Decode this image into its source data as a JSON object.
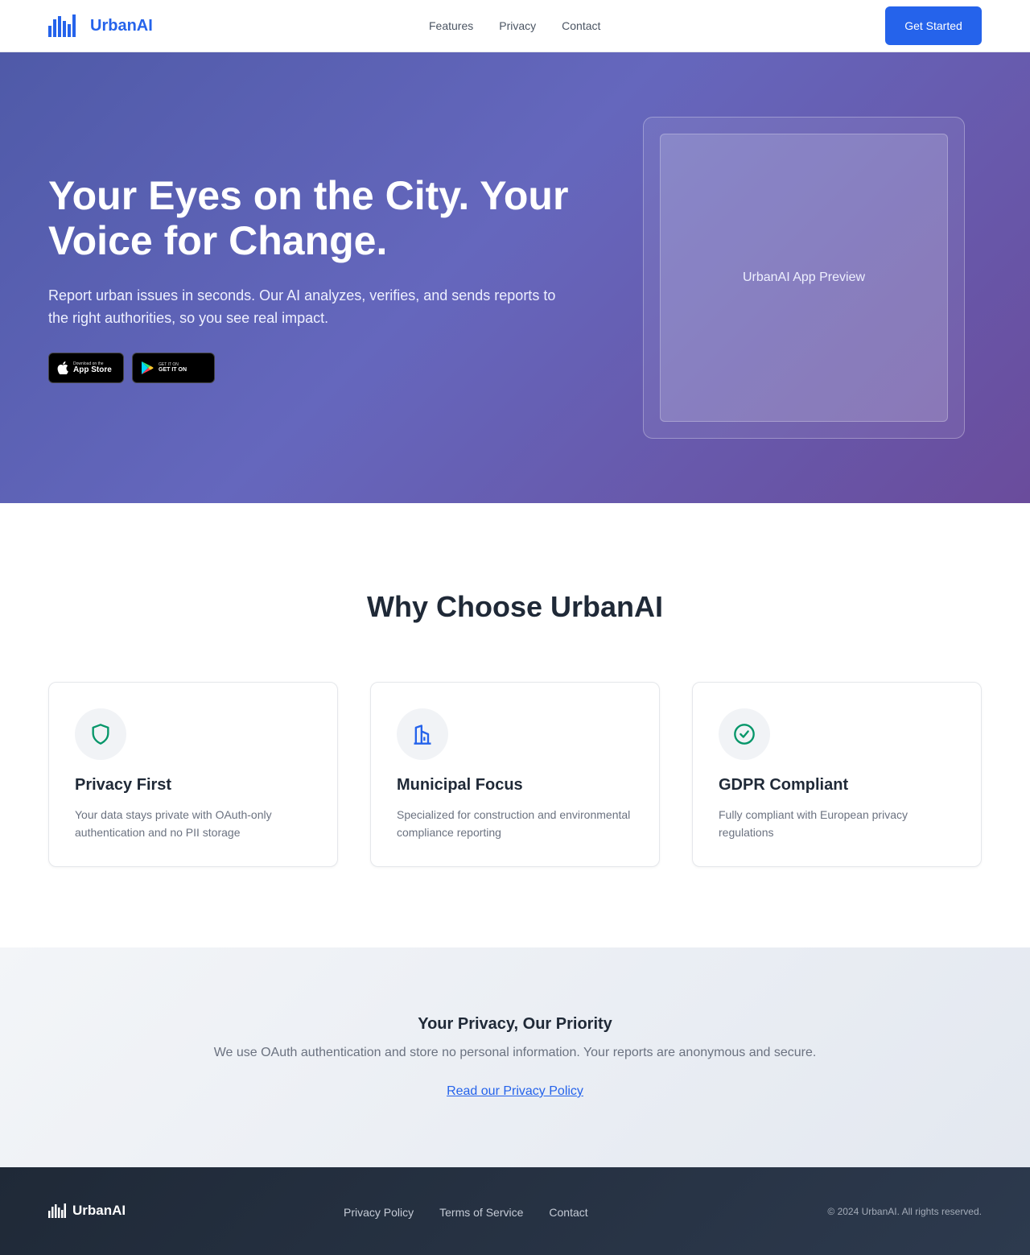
{
  "nav": {
    "brand": "UrbanAI",
    "links": [
      "Features",
      "Privacy",
      "Contact"
    ],
    "cta": "Get Started"
  },
  "hero": {
    "title": "Your Eyes on the City. Your Voice for Change.",
    "subtitle": "Report urban issues in seconds. Our AI analyzes, verifies, and sends reports to the right authorities, so you see real impact.",
    "app_store": {
      "small": "Download on the",
      "big": "App Store"
    },
    "google_play": {
      "small": "GET IT ON",
      "big": "GET IT ON"
    },
    "preview_label": "UrbanAI App Preview"
  },
  "features": {
    "title": "Why Choose UrbanAI",
    "cards": [
      {
        "icon": "shield-icon",
        "title": "Privacy First",
        "desc": "Your data stays private with OAuth-only authentication and no PII storage"
      },
      {
        "icon": "building-icon",
        "title": "Municipal Focus",
        "desc": "Specialized for construction and environmental compliance reporting"
      },
      {
        "icon": "check-circle-icon",
        "title": "GDPR Compliant",
        "desc": "Fully compliant with European privacy regulations"
      }
    ]
  },
  "privacy": {
    "title": "Your Privacy, Our Priority",
    "text": "We use OAuth authentication and store no personal information. Your reports are anonymous and secure.",
    "link": "Read our Privacy Policy"
  },
  "footer": {
    "brand": "UrbanAI",
    "links": [
      "Privacy Policy",
      "Terms of Service",
      "Contact"
    ],
    "copyright": "© 2024 UrbanAI. All rights reserved."
  },
  "colors": {
    "brand": "#2563eb",
    "icon_green": "#059669",
    "hero_gradient_start": "#4f5aa8",
    "hero_gradient_end": "#6a4c9c",
    "footer_bg": "#1f2937"
  }
}
